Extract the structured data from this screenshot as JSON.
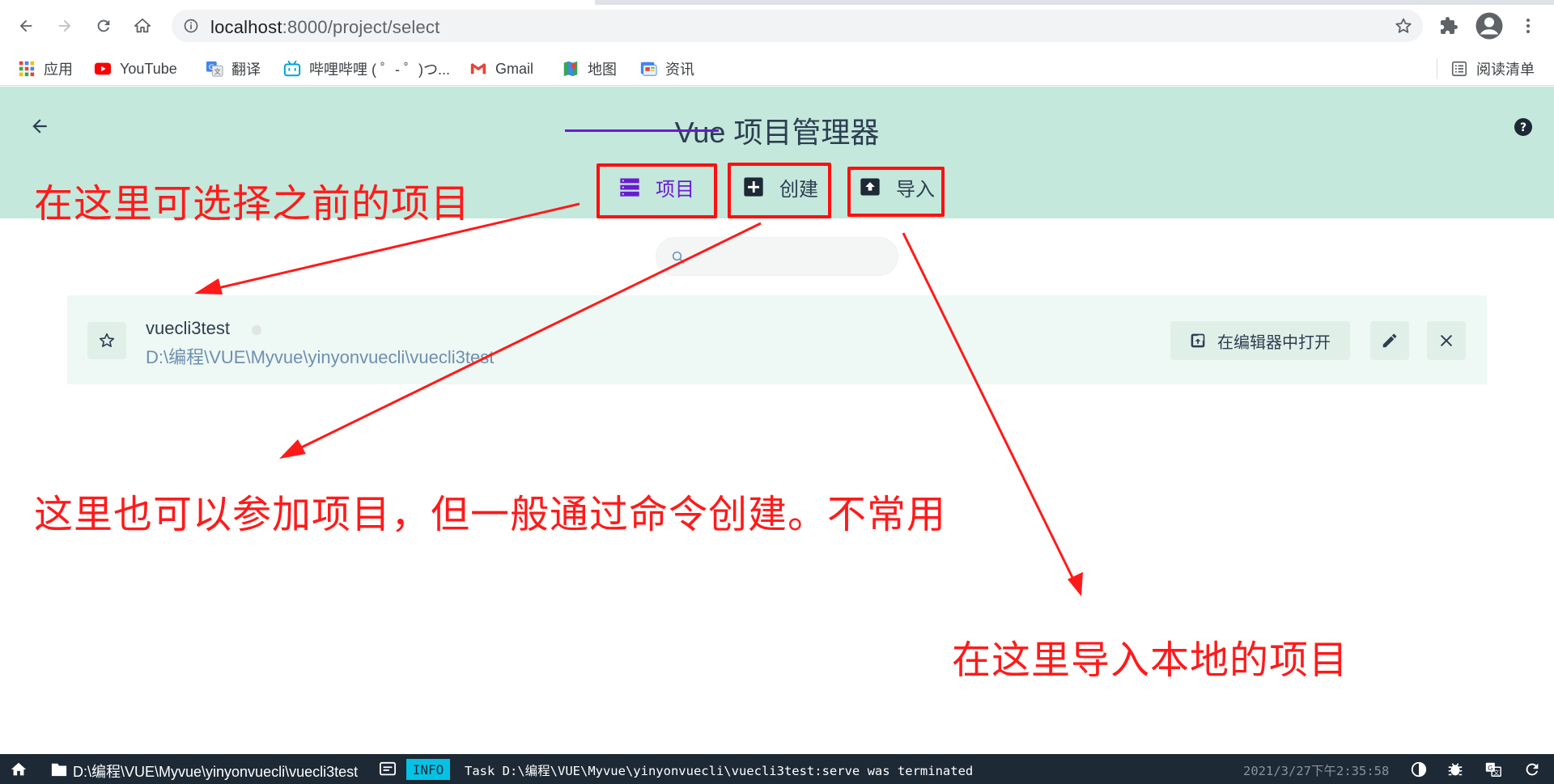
{
  "browser": {
    "url_host": "localhost",
    "url_rest": ":8000/project/select",
    "bookmarks": [
      {
        "label": "应用",
        "icon": "apps-grid-icon"
      },
      {
        "label": "YouTube",
        "icon": "youtube-icon"
      },
      {
        "label": "翻译",
        "icon": "translate-icon"
      },
      {
        "label": "哔哩哔哩 ( ゜- ゜)つ...",
        "icon": "bilibili-icon"
      },
      {
        "label": "Gmail",
        "icon": "gmail-icon"
      },
      {
        "label": "地图",
        "icon": "maps-icon"
      },
      {
        "label": "资讯",
        "icon": "news-icon"
      }
    ],
    "reading_list": "阅读清单"
  },
  "app": {
    "title": "Vue 项目管理器",
    "tabs": [
      {
        "label": "项目",
        "icon": "list-icon",
        "active": true
      },
      {
        "label": "创建",
        "icon": "plus-box-icon",
        "active": false
      },
      {
        "label": "导入",
        "icon": "unarchive-icon",
        "active": false
      }
    ],
    "accent_color": "#6a1bd1",
    "header_color": "#c4e8dc"
  },
  "project": {
    "name": "vuecli3test",
    "path": "D:\\编程\\VUE\\Myvue\\yinyonvuecli\\vuecli3test",
    "open_in_editor_label": "在编辑器中打开"
  },
  "annotations": {
    "select_previous": "在这里可选择之前的项目",
    "create_note": "这里也可以参加项目，但一般通过命令创建。不常用",
    "import_note": "在这里导入本地的项目",
    "color": "#ff1a1a"
  },
  "statusbar": {
    "path": "D:\\编程\\VUE\\Myvue\\yinyonvuecli\\vuecli3test",
    "level": "INFO",
    "message": "Task D:\\编程\\VUE\\Myvue\\yinyonvuecli\\vuecli3test:serve was terminated",
    "time": "2021/3/27下午2:35:58"
  }
}
